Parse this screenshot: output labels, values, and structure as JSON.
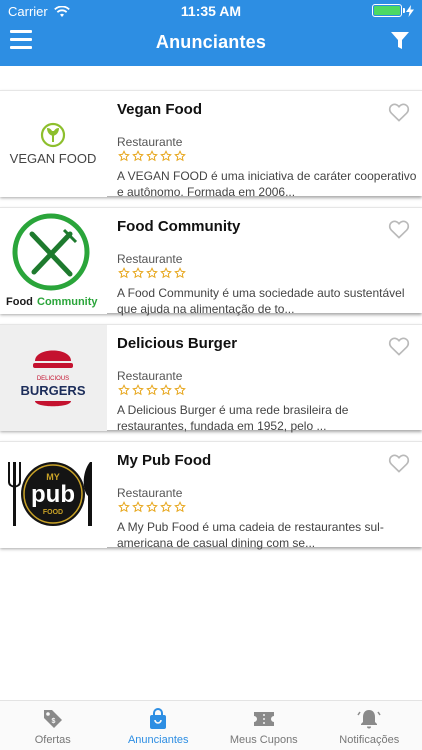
{
  "status": {
    "carrier": "Carrier",
    "time": "11:35 AM"
  },
  "nav": {
    "title": "Anunciantes"
  },
  "colors": {
    "primary": "#2d8ee3",
    "star": "#e7a71e",
    "heart": "#b9b9b9",
    "tab_inactive": "#8a8a8a"
  },
  "advertisers": [
    {
      "name": "Vegan Food",
      "category": "Restaurante",
      "rating": 0,
      "desc1": "A VEGAN FOOD é uma iniciativa de caráter cooperativo",
      "desc2": "e autônomo. Formada em 2006...",
      "logo_text": "VEGAN FOOD"
    },
    {
      "name": "Food Community",
      "category": "Restaurante",
      "rating": 0,
      "desc1": "A Food Community é uma sociedade auto sustentável",
      "desc2": "que ajuda na alimentação de to...",
      "logo_text_a": "Food",
      "logo_text_b": "Community"
    },
    {
      "name": "Delicious Burger",
      "category": "Restaurante",
      "rating": 0,
      "desc1": "A Delicious Burger é uma rede brasileira de",
      "desc2": "restaurantes, fundada em 1952, pelo ...",
      "logo_text_a": "DELICIOUS",
      "logo_text_b": "BURGERS"
    },
    {
      "name": "My Pub Food",
      "category": "Restaurante",
      "rating": 0,
      "desc1": "A My Pub Food é uma cadeia de restaurantes sul-",
      "desc2": "americana de casual dining com se...",
      "logo_text_a": "MY",
      "logo_text_b": "pub",
      "logo_text_c": "FOOD"
    }
  ],
  "tabs": [
    {
      "label": "Ofertas",
      "icon": "tag-icon",
      "active": false
    },
    {
      "label": "Anunciantes",
      "icon": "shopping-bag-icon",
      "active": true
    },
    {
      "label": "Meus Cupons",
      "icon": "ticket-icon",
      "active": false
    },
    {
      "label": "Notificações",
      "icon": "bell-icon",
      "active": false
    }
  ]
}
